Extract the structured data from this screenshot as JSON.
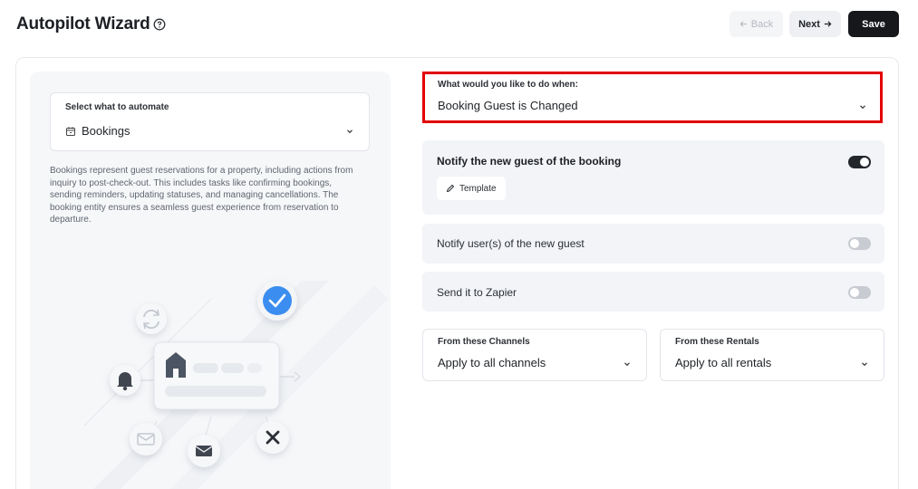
{
  "header": {
    "title": "Autopilot Wizard",
    "back_label": "Back",
    "next_label": "Next",
    "save_label": "Save"
  },
  "left": {
    "select_label": "Select what to automate",
    "select_value": "Bookings",
    "description": "Bookings represent guest reservations for a property, including actions from inquiry to post-check-out. This includes tasks like confirming bookings, sending reminders, updating statuses, and managing cancellations. The booking entity ensures a seamless guest experience from reservation to departure."
  },
  "trigger": {
    "label": "What would you like to do when:",
    "value": "Booking Guest is Changed"
  },
  "actions": [
    {
      "label": "Notify the new guest of the booking",
      "enabled": true,
      "button": "Template"
    },
    {
      "label": "Notify user(s) of the new guest",
      "enabled": false
    },
    {
      "label": "Send it to Zapier",
      "enabled": false
    }
  ],
  "filters": {
    "channels": {
      "label": "From these Channels",
      "value": "Apply to all channels"
    },
    "rentals": {
      "label": "From these Rentals",
      "value": "Apply to all rentals"
    }
  },
  "icons": {
    "help": "help-circle-icon",
    "calendar": "calendar-icon",
    "chevron": "chevron-down-icon",
    "pencil": "pencil-icon",
    "arrow_left": "arrow-left-icon",
    "arrow_right": "arrow-right-icon"
  },
  "colors": {
    "highlight": "#e30000",
    "primary": "#16181c",
    "check": "#3b8ef0"
  }
}
